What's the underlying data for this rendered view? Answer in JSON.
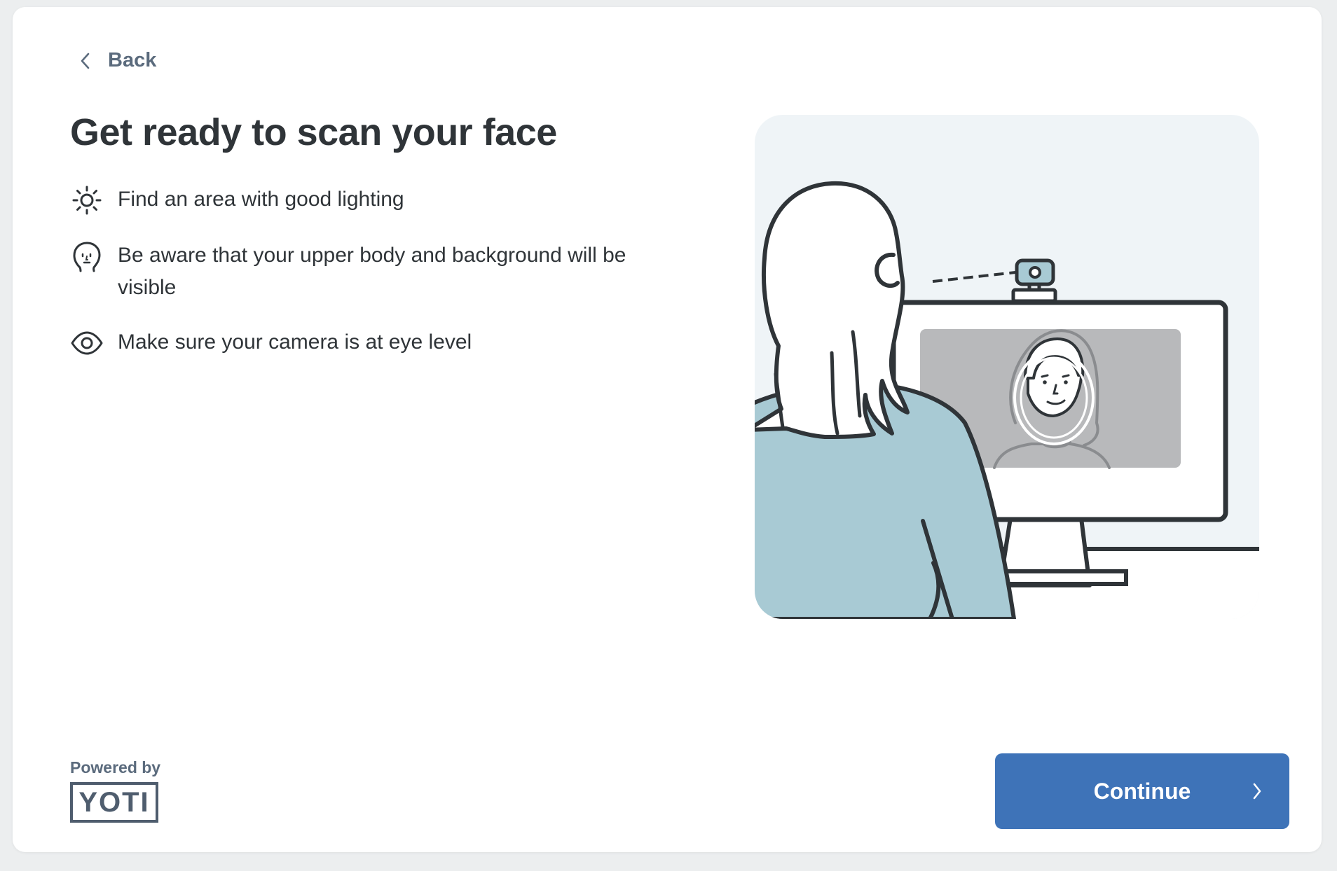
{
  "nav": {
    "back_label": "Back"
  },
  "page": {
    "title": "Get ready to scan your face"
  },
  "tips": [
    {
      "icon": "sun-icon",
      "text": "Find an area with good lighting"
    },
    {
      "icon": "face-outline-icon",
      "text": "Be aware that your upper body and background will be visible"
    },
    {
      "icon": "eye-icon",
      "text": "Make sure your camera is at eye level"
    }
  ],
  "footer": {
    "powered_by": "Powered by",
    "logo_text": "YOTI",
    "continue_label": "Continue"
  },
  "colors": {
    "primary_button": "#3e73b8",
    "text": "#2f3438",
    "muted": "#5b6b7d",
    "illustration_bg": "#eff4f7",
    "illustration_accent": "#a8cad4"
  }
}
